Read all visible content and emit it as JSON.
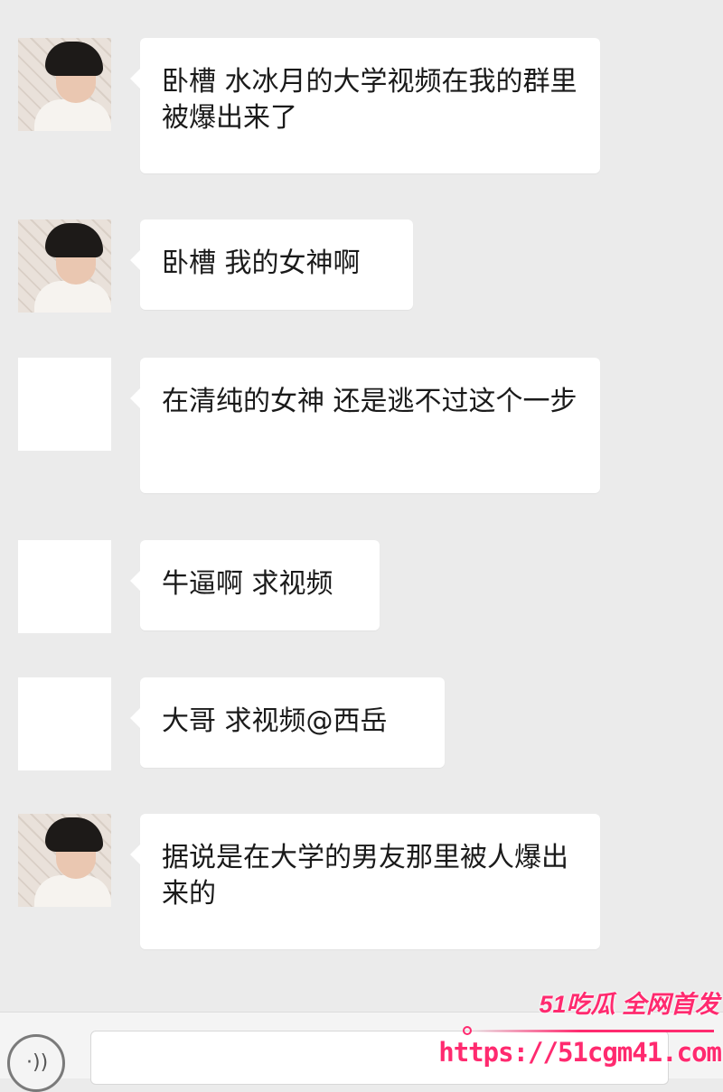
{
  "chat": {
    "messages": [
      {
        "avatar": "photo-avatar",
        "text": "卧槽 水冰月的大学视频在我的群里被爆出来了"
      },
      {
        "avatar": "photo-avatar",
        "text": "卧槽 我的女神啊"
      },
      {
        "avatar": "blank-avatar",
        "text": "在清纯的女神 还是逃不过这个一步"
      },
      {
        "avatar": "blank-avatar",
        "text": "牛逼啊 求视频"
      },
      {
        "avatar": "blank-avatar",
        "text": "大哥 求视频@西岳"
      },
      {
        "avatar": "photo-avatar",
        "text": "据说是在大学的男友那里被人爆出来的"
      }
    ]
  },
  "input_bar": {
    "voice_icon": "voice-icon",
    "voice_glyph": "·))"
  },
  "watermark": {
    "line1": "51吃瓜 全网首发",
    "line2": "https://51cgm41.com",
    "color": "#ff2a6f"
  }
}
